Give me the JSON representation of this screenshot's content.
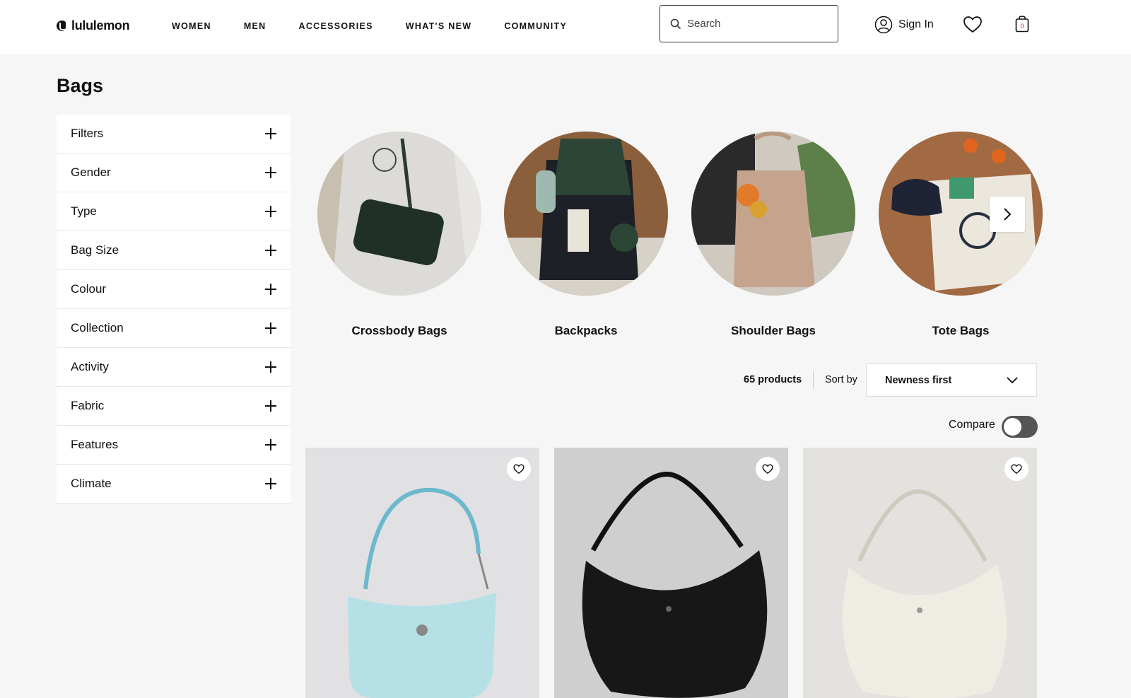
{
  "header": {
    "brand": "lululemon",
    "nav": [
      "WOMEN",
      "MEN",
      "ACCESSORIES",
      "WHAT'S NEW",
      "COMMUNITY"
    ],
    "search_placeholder": "Search",
    "sign_in": "Sign In",
    "cart_count": "0"
  },
  "page": {
    "title": "Bags"
  },
  "filters": [
    "Filters",
    "Gender",
    "Type",
    "Bag Size",
    "Colour",
    "Collection",
    "Activity",
    "Fabric",
    "Features",
    "Climate"
  ],
  "categories": [
    "Crossbody Bags",
    "Backpacks",
    "Shoulder Bags",
    "Tote Bags"
  ],
  "results": {
    "count": "65 products",
    "sort_label": "Sort by",
    "sort_value": "Newness first",
    "compare_label": "Compare"
  },
  "colors": {
    "accent": "#d31f26",
    "text": "#111111",
    "background": "#f6f6f6"
  }
}
